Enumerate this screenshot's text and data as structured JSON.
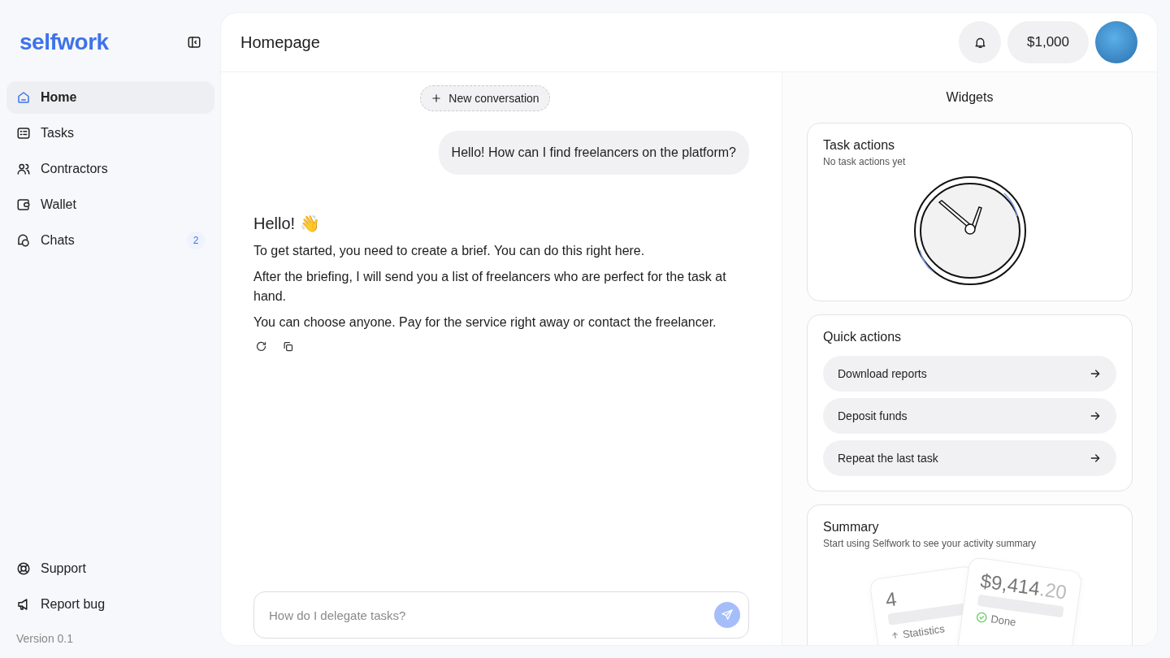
{
  "sidebar": {
    "logo": "selfwork",
    "items": [
      {
        "label": "Home",
        "selected": true
      },
      {
        "label": "Tasks",
        "selected": false
      },
      {
        "label": "Contractors",
        "selected": false
      },
      {
        "label": "Wallet",
        "selected": false
      },
      {
        "label": "Chats",
        "selected": false,
        "badge": "2"
      }
    ],
    "footer_items": [
      {
        "label": "Support"
      },
      {
        "label": "Report bug"
      }
    ],
    "version": "Version 0.1"
  },
  "header": {
    "title": "Homepage",
    "balance": "$1,000"
  },
  "chat": {
    "new_conversation": "New conversation",
    "user_message": "Hello! How can I find freelancers on the platform?",
    "reply": {
      "heading": "Hello! 👋",
      "paragraphs": [
        "To get started, you need to create a brief. You can do this right here.",
        "After the briefing, I will send you a list of freelancers who are perfect for the task at hand.",
        "You can choose anyone. Pay for the service right away or contact the freelancer."
      ]
    },
    "input": {
      "placeholder": "How do I delegate tasks?"
    }
  },
  "widgets": {
    "title": "Widgets",
    "task_actions": {
      "title": "Task actions",
      "subtitle": "No task actions yet"
    },
    "quick_actions": {
      "title": "Quick actions",
      "actions": [
        "Download reports",
        "Deposit funds",
        "Repeat the last task"
      ]
    },
    "summary": {
      "title": "Summary",
      "subtitle": "Start using Selfwork to see your activity summary",
      "count": "4",
      "count_label": "Statistics",
      "amount": "$9,414",
      "amount_cents": ".20",
      "amount_label": "Done"
    }
  }
}
